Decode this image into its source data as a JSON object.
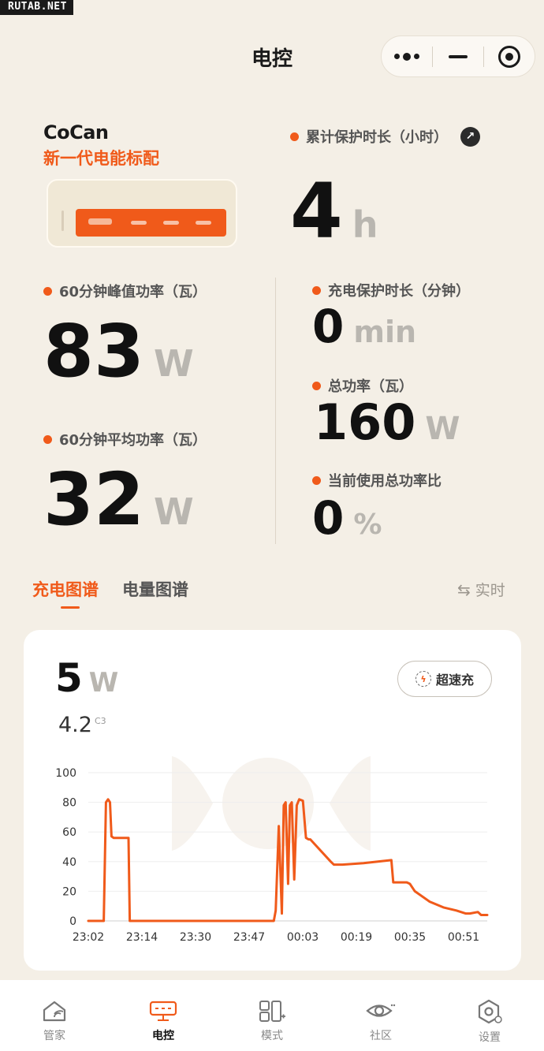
{
  "watermark": "RUTAB.NET",
  "nav": {
    "title": "电控"
  },
  "product": {
    "brand": "CoCan",
    "slogan": "新一代电能标配"
  },
  "stats": {
    "cumulative_protection": {
      "label": "累计保护时长（小时）",
      "value": "4",
      "unit": "h"
    },
    "peak_power": {
      "label": "60分钟峰值功率（瓦）",
      "value": "83",
      "unit": "W"
    },
    "avg_power": {
      "label": "60分钟平均功率（瓦）",
      "value": "32",
      "unit": "W"
    },
    "charge_protection": {
      "label": "充电保护时长（分钟）",
      "value": "0",
      "unit": "min"
    },
    "total_power": {
      "label": "总功率（瓦）",
      "value": "160",
      "unit": "W"
    },
    "usage_ratio": {
      "label": "当前使用总功率比",
      "value": "0",
      "unit": "%"
    }
  },
  "tabs": {
    "charge": "充电图谱",
    "energy": "电量图谱",
    "realtime": "实时"
  },
  "chart_panel": {
    "current_value": "5",
    "current_unit": "W",
    "voltage": "4.2",
    "voltage_port": "C3",
    "turbo_label": "超速充"
  },
  "chart_data": {
    "type": "line",
    "x_ticks": [
      "23:02",
      "23:14",
      "23:30",
      "23:47",
      "00:03",
      "00:19",
      "00:35",
      "00:51"
    ],
    "y_ticks": [
      0,
      20,
      40,
      60,
      80,
      100
    ],
    "ylim": [
      0,
      100
    ],
    "xlim_minutes": [
      0,
      129
    ],
    "grid": true,
    "color": "#f05a1a",
    "x_minutes": [
      0,
      5,
      5.7,
      6.4,
      7,
      7.5,
      8.2,
      13,
      13.4,
      14,
      60,
      60.6,
      61.6,
      62.6,
      63.2,
      63.8,
      64.6,
      65.2,
      65.8,
      66.6,
      67.4,
      68.2,
      69.4,
      70.4,
      71.2,
      71.8,
      78.4,
      79.4,
      82.2,
      89,
      98,
      98.6,
      103,
      104,
      105.6,
      110.4,
      115,
      119,
      122,
      123.4,
      126,
      127,
      129
    ],
    "y_values": [
      0,
      0,
      80,
      82,
      80,
      57,
      56,
      56,
      0,
      0,
      0,
      7,
      64,
      5,
      78,
      80,
      25,
      78,
      80,
      28,
      78,
      82,
      81,
      56,
      55,
      55,
      40,
      38,
      38,
      39,
      41,
      26,
      26,
      25,
      20,
      13,
      9,
      7,
      5,
      5,
      6,
      4,
      4
    ]
  },
  "tabbar": [
    {
      "label": "管家",
      "icon": "home-icon"
    },
    {
      "label": "电控",
      "icon": "power-strip-icon"
    },
    {
      "label": "模式",
      "icon": "modes-icon"
    },
    {
      "label": "社区",
      "icon": "eye-icon"
    },
    {
      "label": "设置",
      "icon": "settings-icon"
    }
  ]
}
